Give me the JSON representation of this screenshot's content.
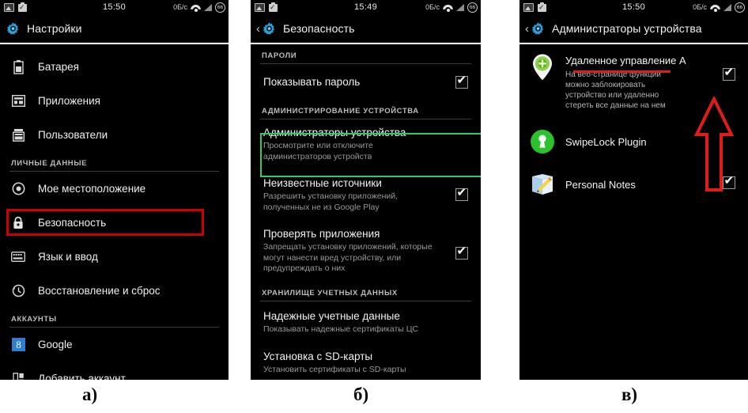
{
  "figure": {
    "captions": [
      {
        "id": "a",
        "text": "а)"
      },
      {
        "id": "b",
        "text": "б)"
      },
      {
        "id": "c",
        "text": "в)"
      }
    ],
    "accent_red": "#cc0000",
    "accent_green": "#2ecb6a",
    "background": "#000000"
  },
  "panel_a": {
    "status_bar": {
      "clock": "15:50",
      "data_rate": "0Б/c",
      "battery_level": "66",
      "icons": [
        "gallery-icon",
        "briefcase-icon",
        "wifi-icon",
        "signal-icon",
        "battery-icon"
      ]
    },
    "action_bar": {
      "title": "Настройки",
      "icon": "settings-gear-icon"
    },
    "rows": [
      {
        "label": "Батарея",
        "icon": "battery-icon"
      },
      {
        "label": "Приложения",
        "icon": "apps-icon"
      },
      {
        "label": "Пользователи",
        "icon": "users-icon"
      }
    ],
    "section_header": "ЛИЧНЫЕ ДАННЫЕ",
    "rows2": [
      {
        "label": "Мое местоположение",
        "icon": "location-icon"
      },
      {
        "label": "Безопасность",
        "icon": "lock-icon",
        "highlighted": true
      },
      {
        "label": "Язык и ввод",
        "icon": "keyboard-icon"
      },
      {
        "label": "Восстановление и сброс",
        "icon": "restore-icon"
      }
    ],
    "section_header2": "АККАУНТЫ",
    "rows3": [
      {
        "label": "Google",
        "icon": "google-icon"
      },
      {
        "label": "Добавить аккаунт",
        "icon": "add-account-icon"
      }
    ]
  },
  "panel_b": {
    "status_bar": {
      "clock": "15:49",
      "data_rate": "0Б/c",
      "battery_level": "66"
    },
    "action_bar": {
      "title": "Безопасность",
      "icon": "settings-gear-icon",
      "back": "‹"
    },
    "section_passwords": "ПАРОЛИ",
    "row_show_password": {
      "title": "Показывать пароль",
      "checked": true
    },
    "section_device_admin": "АДМИНИСТРИРОВАНИЕ УСТРОЙСТВА",
    "row_device_admins": {
      "title": "Администраторы устройства",
      "subtitle": "Просмотрите или отключите администраторов устройств",
      "highlighted": true
    },
    "row_unknown_sources": {
      "title": "Неизвестные источники",
      "subtitle": "Разрешить установку приложений, полученных не из Google Play",
      "checked": true
    },
    "row_verify_apps": {
      "title": "Проверять приложения",
      "subtitle": "Запрещать установку приложений, которые могут нанести вред устройству, или предупреждать о них",
      "checked": true
    },
    "section_credentials": "ХРАНИЛИЩЕ УЧЕТНЫХ ДАННЫХ",
    "row_trusted": {
      "title": "Надежные учетные данные",
      "subtitle": "Показывать надежные сертификаты ЦС"
    },
    "row_sdcard": {
      "title": "Установка с SD-карты",
      "subtitle": "Установить сертификаты с SD-карты"
    }
  },
  "panel_c": {
    "status_bar": {
      "clock": "15:50",
      "data_rate": "0Б/c",
      "battery_level": "66"
    },
    "action_bar": {
      "title": "Администраторы устройства",
      "icon": "settings-gear-icon",
      "back": "‹"
    },
    "rows": [
      {
        "title": "Удаленное управление А",
        "subtitle": "На веб-странице функции можно заблокировать устройство или удаленно стереть все данные на нем",
        "icon": "location-pin-icon",
        "checked": true,
        "underlined": true
      },
      {
        "title": "SwipeLock Plugin",
        "subtitle": "",
        "icon": "keyhole-icon",
        "checked": false
      },
      {
        "title": "Personal Notes",
        "subtitle": "",
        "icon": "notes-pencil-icon",
        "checked": true
      }
    ],
    "annotation": {
      "type": "up-arrow",
      "color": "#e01b1b"
    }
  }
}
